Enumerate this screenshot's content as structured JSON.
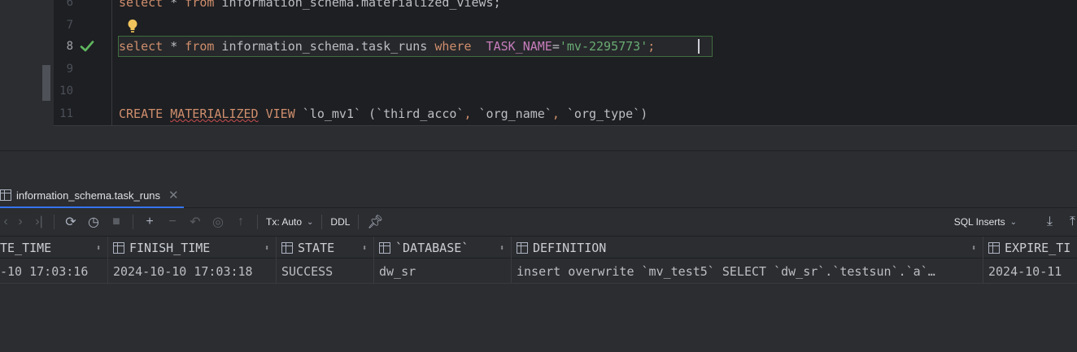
{
  "editor": {
    "line_numbers": [
      "6",
      "7",
      "8",
      "9",
      "10",
      "11"
    ],
    "line6": {
      "kw1": "select",
      "rest1": " * ",
      "kw2": "from",
      "rest2": " information_schema.materialized_views;"
    },
    "line8": {
      "kw1": "select",
      "star": " * ",
      "kw2": "from",
      "table": " information_schema.task_runs ",
      "kw3": "where",
      "col": "  TASK_NAME",
      "eq": "=",
      "str": "'mv-2295773'",
      "semi": ";"
    },
    "line11": {
      "kw1": "CREATE",
      "kw2": "MATERIALIZED",
      "kw3": "VIEW",
      "name": " `lo_mv1` (`third_acco`",
      "c1": ",",
      "p2": " `org_name`",
      "c2": ",",
      "p3": " `org_type`)"
    }
  },
  "results": {
    "tab_label": "information_schema.task_runs",
    "toolbar": {
      "tx_label": "Tx: Auto",
      "ddl_label": "DDL",
      "export_format": "SQL Inserts"
    },
    "columns": [
      "TE_TIME",
      "FINISH_TIME",
      "STATE",
      "`DATABASE`",
      "DEFINITION",
      "EXPIRE_TI"
    ],
    "row": {
      "create_time": "-10 17:03:16",
      "finish_time": "2024-10-10 17:03:18",
      "state": "SUCCESS",
      "database": "dw_sr",
      "definition": "insert overwrite `mv_test5` SELECT `dw_sr`.`testsun`.`a`…",
      "expire_time": "2024-10-11"
    }
  },
  "colors": {
    "keyword": "#cf8e6d",
    "string": "#6aab73",
    "column": "#c77dbb",
    "success_check": "#5fb85f",
    "tab_accent": "#3574f0"
  }
}
